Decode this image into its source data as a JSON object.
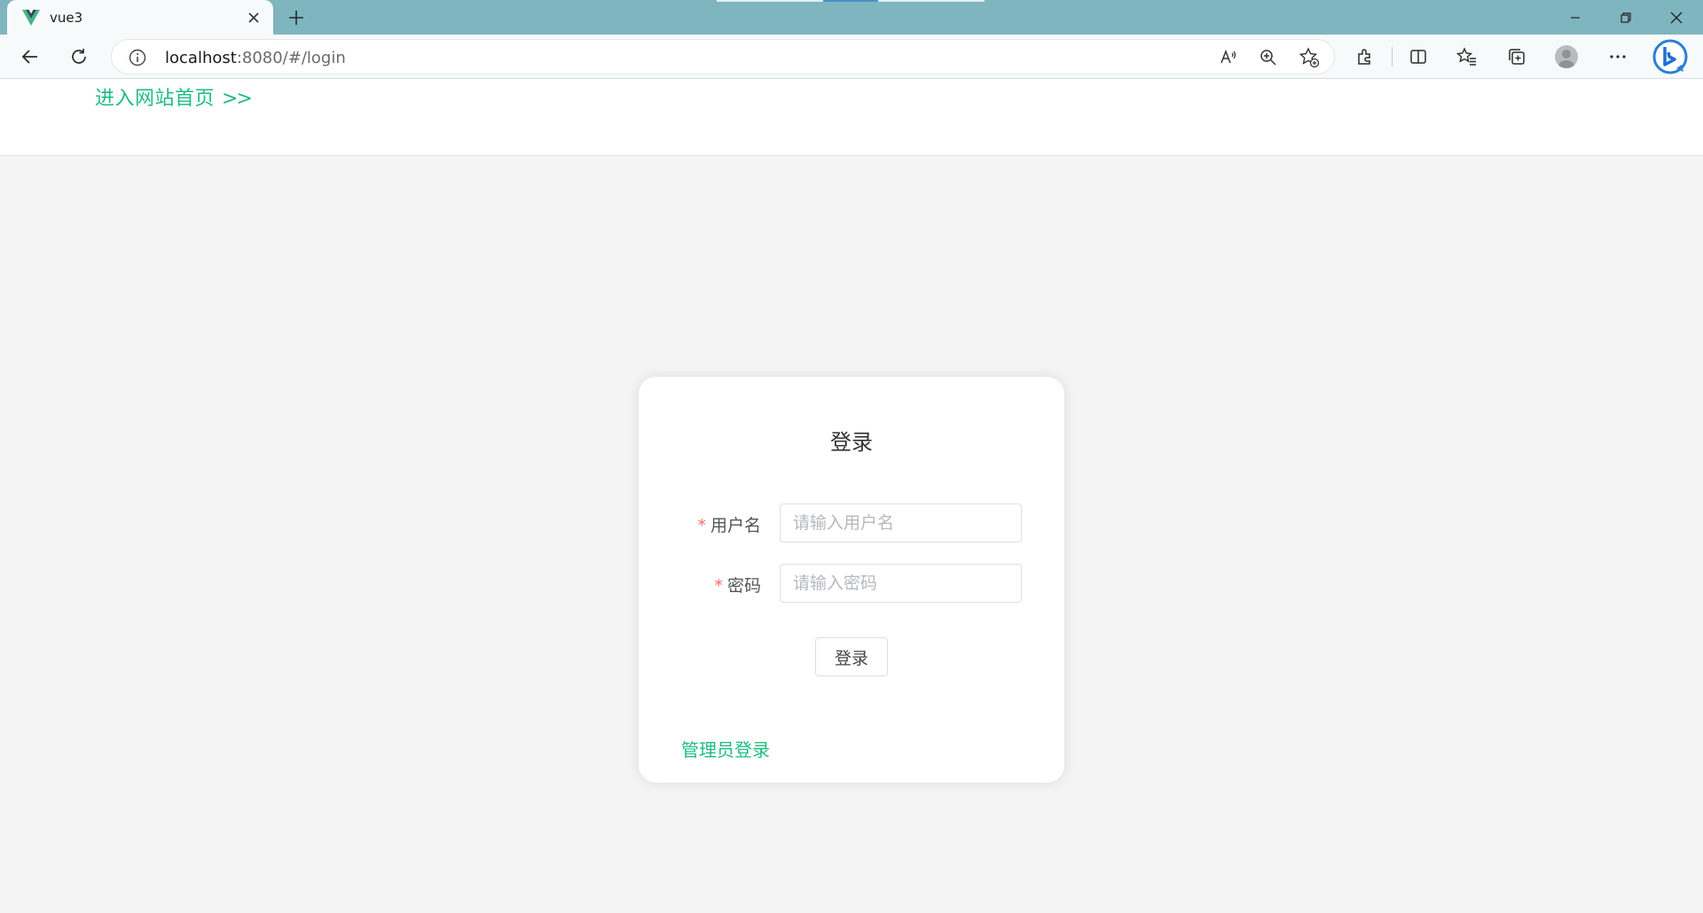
{
  "browser": {
    "tab": {
      "title": "vue3",
      "favicon": "vue-logo-icon"
    },
    "url": {
      "host": "localhost",
      "path": ":8080/#/login"
    },
    "icons": [
      "back-icon",
      "refresh-icon",
      "info-icon",
      "read-aloud-icon",
      "zoom-icon",
      "favorite-add-icon",
      "extensions-icon",
      "split-screen-icon",
      "favorites-icon",
      "collections-icon",
      "profile-avatar",
      "more-icon",
      "bing-icon"
    ],
    "colors": {
      "tabbar": "#7fb5bf",
      "toolbar": "#f7fafa"
    }
  },
  "header": {
    "home_link": "进入网站首页",
    "home_arrows": ">>"
  },
  "login": {
    "title": "登录",
    "username": {
      "label": "用户名",
      "placeholder": "请输入用户名",
      "required_mark": "*"
    },
    "password": {
      "label": "密码",
      "placeholder": "请输入密码",
      "required_mark": "*"
    },
    "submit_label": "登录",
    "admin_link": "管理员登录"
  },
  "colors": {
    "accent": "#1ebd7f",
    "required": "#f56c6c",
    "page_bg": "#f4f4f4"
  }
}
